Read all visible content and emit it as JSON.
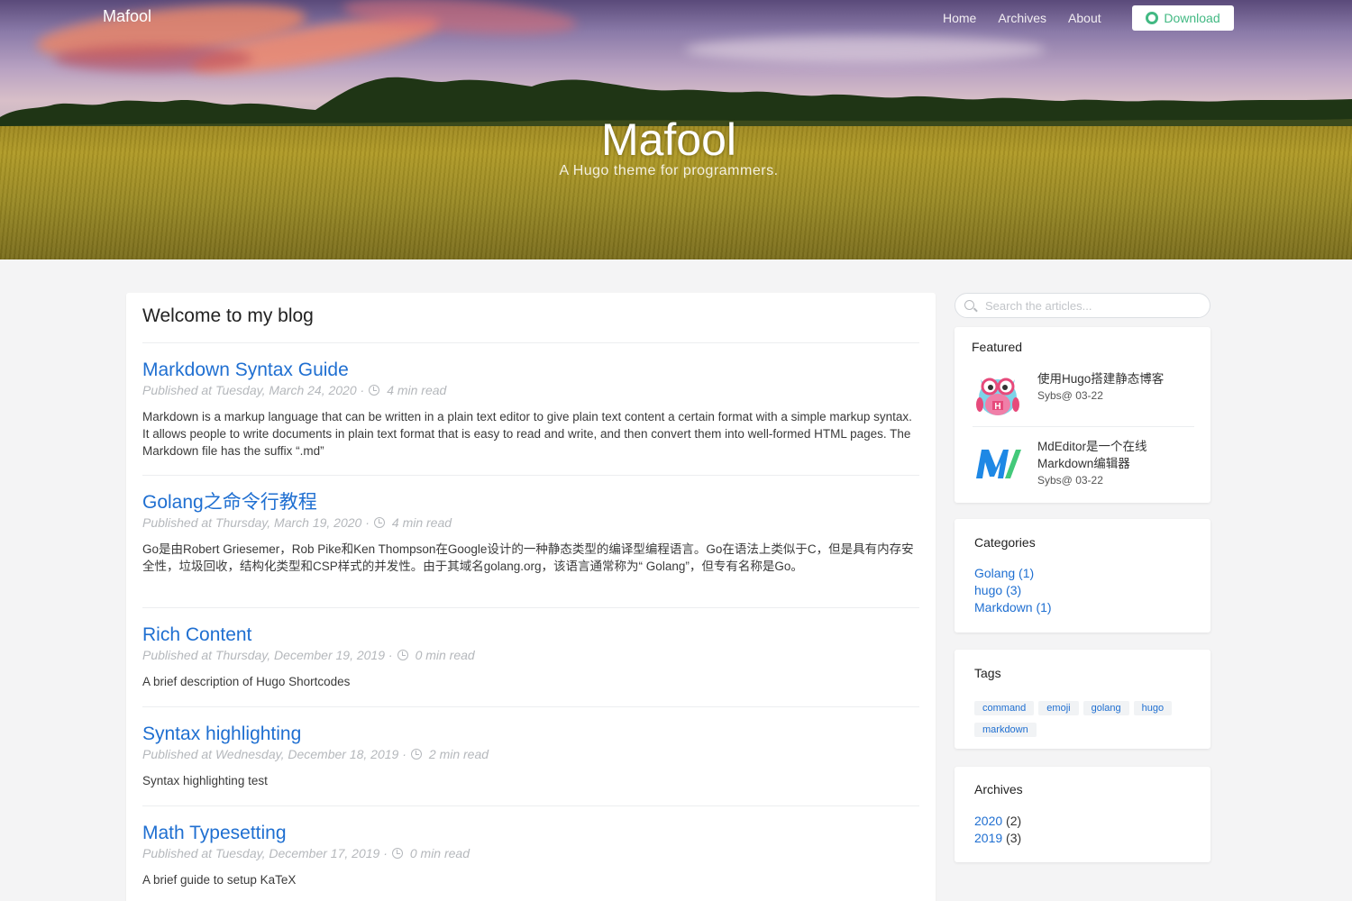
{
  "nav": {
    "brand": "Mafool",
    "links": [
      "Home",
      "Archives",
      "About"
    ],
    "download_label": "Download"
  },
  "hero": {
    "title": "Mafool",
    "subtitle": "A Hugo theme for programmers."
  },
  "main": {
    "title": "Welcome to my blog",
    "posts": [
      {
        "title": "Markdown Syntax Guide",
        "published": "Published at Tuesday, March 24, 2020 ·",
        "read_time": "4 min read",
        "description": "Markdown is a markup language that can be written in a plain text editor to give plain text content a certain format with a simple markup syntax. It allows people to write documents in plain text format that is easy to read and write, and then convert them into well-formed HTML pages. The Markdown file has the suffix “.md”"
      },
      {
        "title": "Golang之命令行教程",
        "published": "Published at Thursday, March 19, 2020 ·",
        "read_time": "4 min read",
        "description": "Go是由Robert Griesemer，Rob Pike和Ken Thompson在Google设计的一种静态类型的编译型编程语言。Go在语法上类似于C，但是具有内存安全性，垃圾回收，结构化类型和CSP样式的并发性。由于其域名golang.org，该语言通常称为“ Golang”，但专有名称是Go。"
      },
      {
        "title": "Rich Content",
        "published": "Published at Thursday, December 19, 2019 ·",
        "read_time": "0 min read",
        "description": "A brief description of Hugo Shortcodes"
      },
      {
        "title": "Syntax highlighting",
        "published": "Published at Wednesday, December 18, 2019 ·",
        "read_time": "2 min read",
        "description": "Syntax highlighting test"
      },
      {
        "title": "Math Typesetting",
        "published": "Published at Tuesday, December 17, 2019 ·",
        "read_time": "0 min read",
        "description": "A brief guide to setup KaTeX"
      }
    ]
  },
  "sidebar": {
    "search_placeholder": "Search the articles...",
    "featured": {
      "title": "Featured",
      "items": [
        {
          "title": "使用Hugo搭建静态博客",
          "meta": "Sybs@ 03-22",
          "icon": "hugo-owl-icon"
        },
        {
          "title": "MdEditor是一个在线Markdown编辑器",
          "meta": "Sybs@ 03-22",
          "icon": "mdeditor-logo-icon"
        }
      ]
    },
    "categories": {
      "title": "Categories",
      "items": [
        "Golang (1)",
        "hugo (3)",
        "Markdown (1)"
      ]
    },
    "tags": {
      "title": "Tags",
      "items": [
        "command",
        "emoji",
        "golang",
        "hugo",
        "markdown"
      ]
    },
    "archives": {
      "title": "Archives",
      "items": [
        {
          "year": "2020",
          "count": "(2)"
        },
        {
          "year": "2019",
          "count": "(3)"
        }
      ]
    }
  },
  "colors": {
    "link": "#1f6fd1",
    "download": "#42b983",
    "background": "#f4f4f5"
  }
}
